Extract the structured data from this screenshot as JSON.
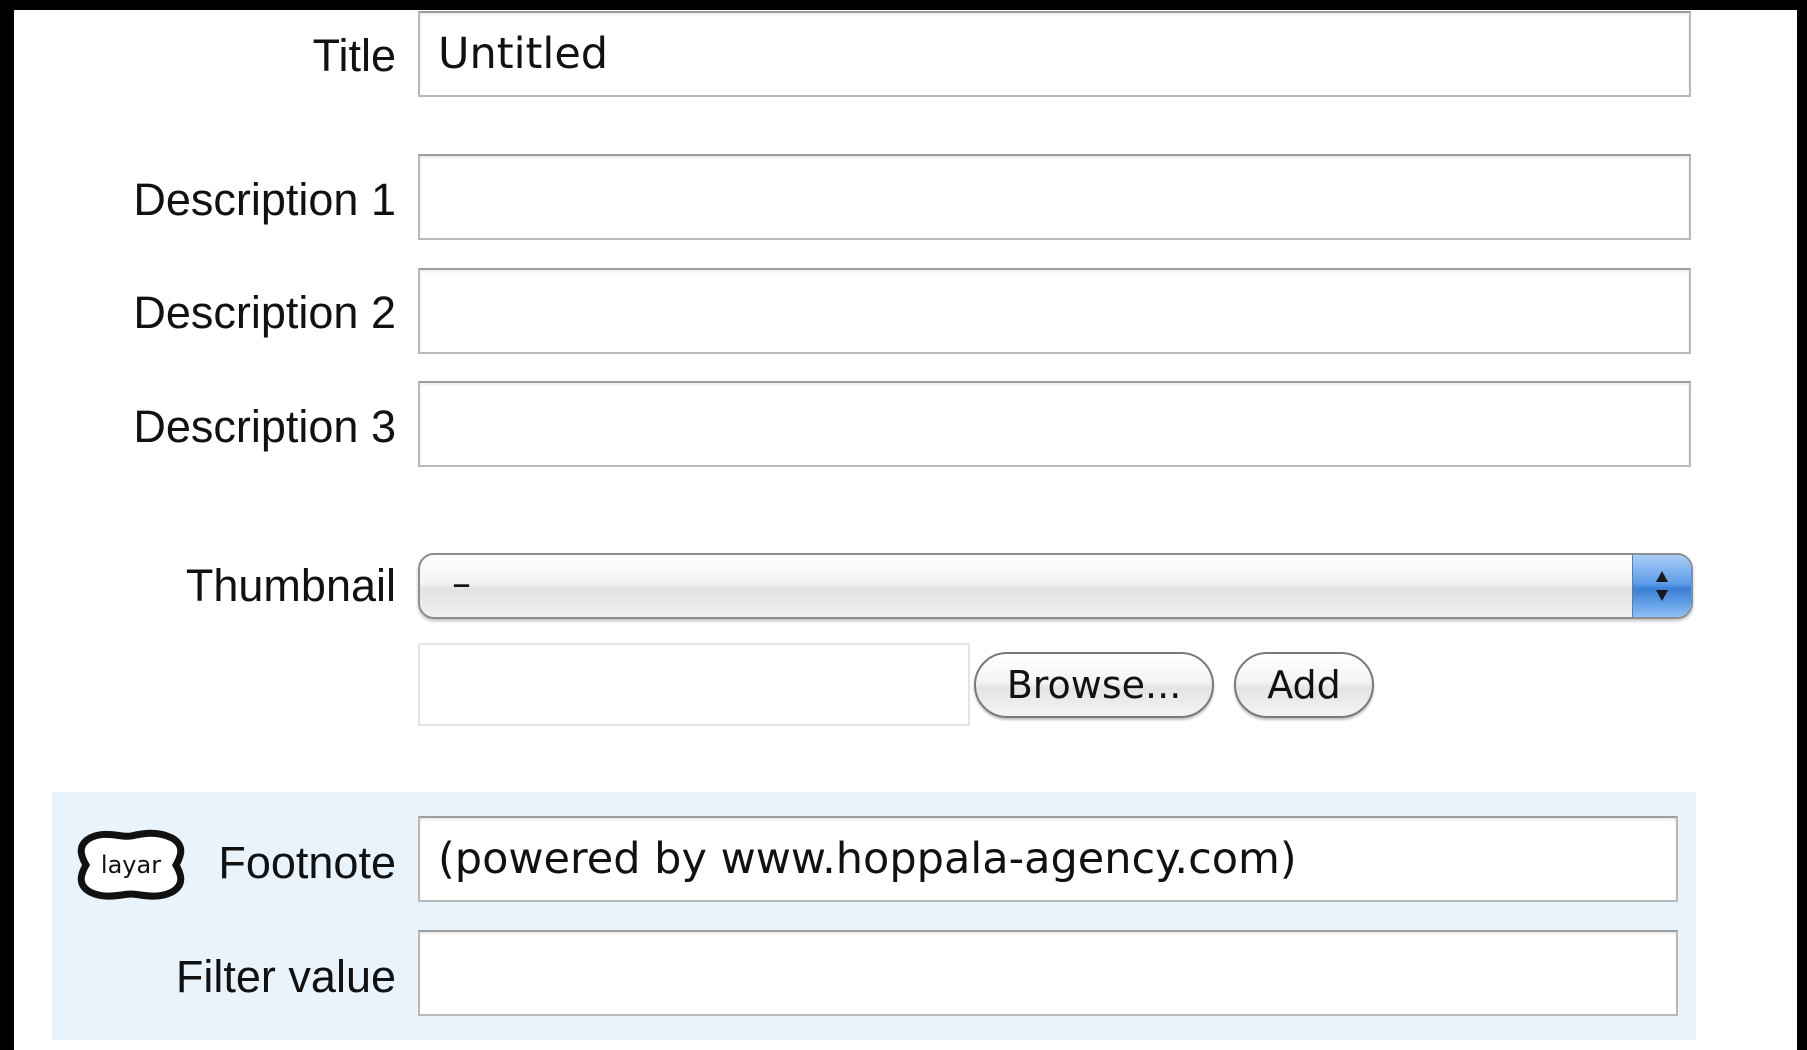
{
  "form": {
    "title_label": "Title",
    "title_value": "Untitled",
    "description1_label": "Description 1",
    "description1_value": "",
    "description2_label": "Description 2",
    "description2_value": "",
    "description3_label": "Description 3",
    "description3_value": "",
    "thumbnail_label": "Thumbnail",
    "thumbnail_selected": "–",
    "browse_label": "Browse...",
    "add_label": "Add"
  },
  "layar": {
    "logo_text": "layar",
    "footnote_label": "Footnote",
    "footnote_value": "(powered by www.hoppala-agency.com)",
    "filter_label": "Filter value",
    "filter_value": ""
  },
  "colors": {
    "background": "#000000",
    "panel": "#ffffff",
    "layar_section": "#e8f3fb",
    "select_arrow_accent": "#3a7fd6"
  },
  "icons": {
    "select_arrows": "up-down-chevron-icon",
    "logo": "layar-logo"
  }
}
